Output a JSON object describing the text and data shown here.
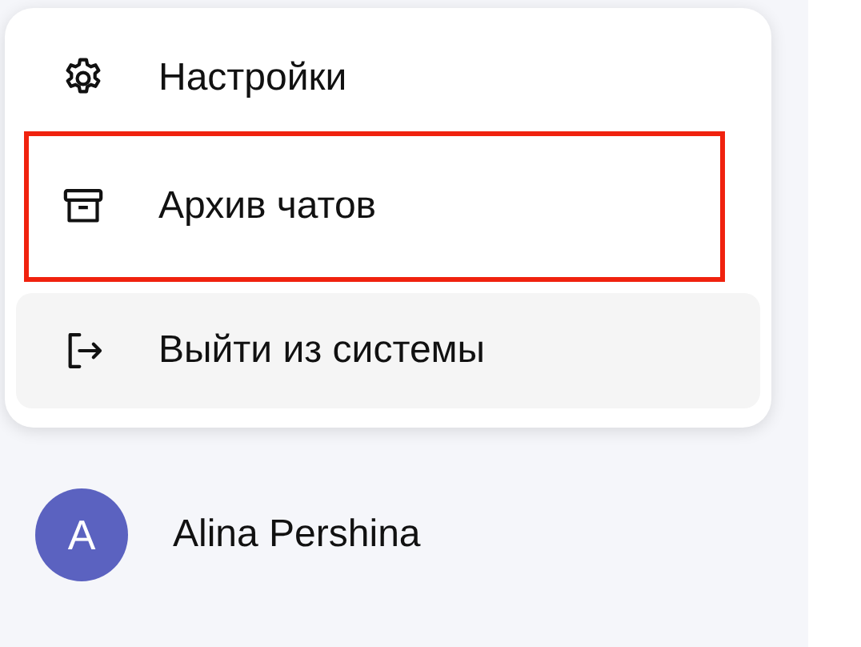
{
  "menu": {
    "items": [
      {
        "kind": "gear",
        "label": "Настройки",
        "hovered": false,
        "highlighted": false
      },
      {
        "kind": "archive",
        "label": "Архив чатов",
        "hovered": false,
        "highlighted": true
      },
      {
        "kind": "logout",
        "label": "Выйти из системы",
        "hovered": true,
        "highlighted": false
      }
    ]
  },
  "user": {
    "initial": "A",
    "name": "Alina Pershina"
  }
}
